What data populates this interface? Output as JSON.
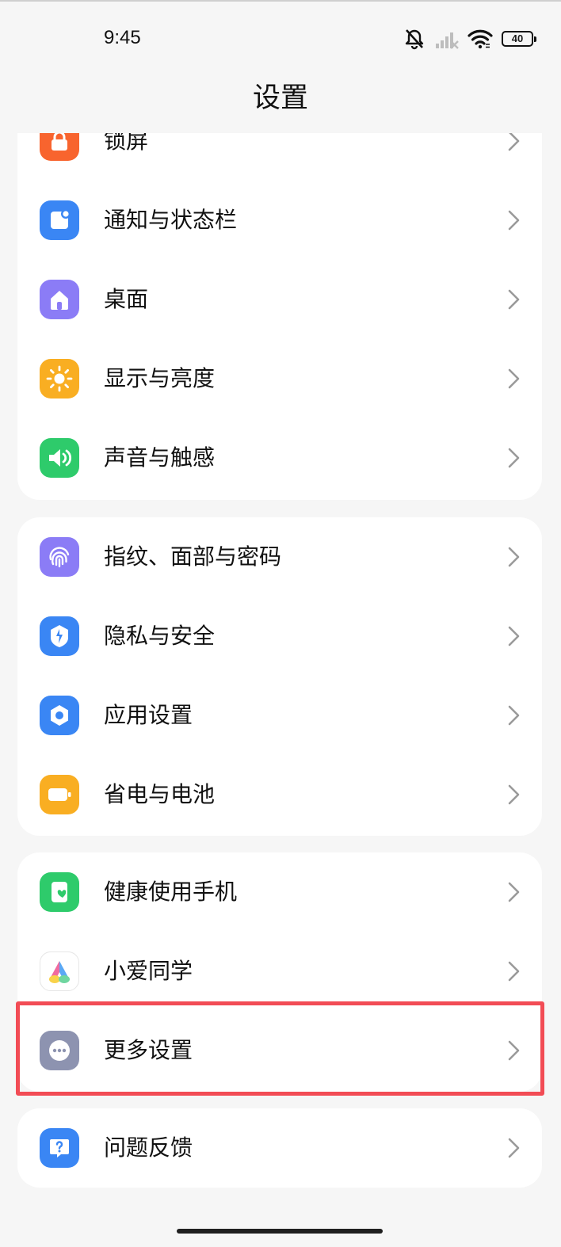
{
  "status": {
    "time": "9:45",
    "battery": "40"
  },
  "header": {
    "title": "设置"
  },
  "groups": [
    {
      "items": [
        {
          "label": "锁屏",
          "icon": "lock-icon",
          "color": "#f8642e"
        },
        {
          "label": "通知与状态栏",
          "icon": "notification-icon",
          "color": "#3a86f4"
        },
        {
          "label": "桌面",
          "icon": "home-icon",
          "color": "#8b7cf6"
        },
        {
          "label": "显示与亮度",
          "icon": "sun-icon",
          "color": "#f9ae22"
        },
        {
          "label": "声音与触感",
          "icon": "speaker-icon",
          "color": "#2ecb6b"
        }
      ]
    },
    {
      "items": [
        {
          "label": "指纹、面部与密码",
          "icon": "fingerprint-icon",
          "color": "#8b7cf6"
        },
        {
          "label": "隐私与安全",
          "icon": "shield-icon",
          "color": "#3a86f4"
        },
        {
          "label": "应用设置",
          "icon": "hexagon-icon",
          "color": "#3a86f4"
        },
        {
          "label": "省电与电池",
          "icon": "battery-icon",
          "color": "#f9ae22"
        }
      ]
    },
    {
      "items": [
        {
          "label": "健康使用手机",
          "icon": "heart-phone-icon",
          "color": "#2ecb6b"
        },
        {
          "label": "小爱同学",
          "icon": "xiaoai-icon",
          "color": "#ffffff"
        },
        {
          "label": "更多设置",
          "icon": "more-icon",
          "color": "#8d93b0"
        }
      ]
    },
    {
      "items": [
        {
          "label": "问题反馈",
          "icon": "feedback-icon",
          "color": "#3a86f4"
        }
      ]
    }
  ],
  "highlight_color": "#f24c55"
}
